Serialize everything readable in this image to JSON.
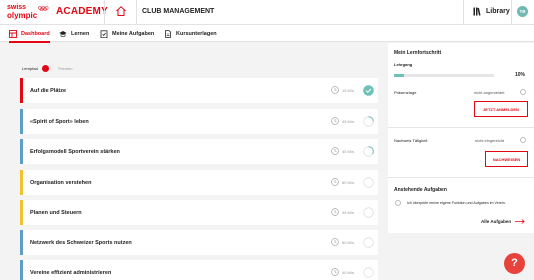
{
  "brand": {
    "line1": "swiss",
    "line2": "olympic",
    "academy": "ACADEMY",
    "accent": "#e30613"
  },
  "header": {
    "title": "CLUB MANAGEMENT",
    "library": "Library",
    "avatar": "TB"
  },
  "nav": {
    "tabs": [
      {
        "label": "Dashboard",
        "icon": "dashboard-icon",
        "active": true
      },
      {
        "label": "Lernen",
        "icon": "graduation-cap-icon"
      },
      {
        "label": "Meine Aufgaben",
        "icon": "clipboard-check-icon"
      },
      {
        "label": "Kursunterlagen",
        "icon": "document-icon"
      }
    ]
  },
  "toggle": {
    "left": "Lernpfad",
    "right": "Themen"
  },
  "courses": [
    {
      "title": "Auf die Plätze",
      "duration": "15 Min.",
      "status": "done",
      "color": "red"
    },
    {
      "title": "«Spirit of Sport» leben",
      "duration": "45 Min.",
      "status": "partial",
      "color": "blue"
    },
    {
      "title": "Erfolgsmodell Sportverein stärken",
      "duration": "45 Min.",
      "status": "partial",
      "color": "blue"
    },
    {
      "title": "Organisation verstehen",
      "duration": "60 Min.",
      "status": "empty",
      "color": "yellow"
    },
    {
      "title": "Planen und Steuern",
      "duration": "45 Min.",
      "status": "empty",
      "color": "yellow"
    },
    {
      "title": "Netzwerk des Schweizer Sports nutzen",
      "duration": "60 Min.",
      "status": "empty",
      "color": "blue"
    },
    {
      "title": "Vereine effizient administrieren",
      "duration": "40 Min.",
      "status": "empty",
      "color": "blue"
    }
  ],
  "progress_panel": {
    "title": "Mein Lernfortschritt",
    "lehrgang_label": "Lehrgang",
    "percent_label": "10%",
    "percent": 10,
    "praesenztage_label": "Präsenztage",
    "praesenztage_status": "nicht angemeldet",
    "anmelden_button": "JETZT ANMELDEN",
    "nachweis_label": "Nachweis Tätigkeit",
    "nachweis_status": "nicht eingereicht",
    "nachweisen_button": "NACHWEISEN"
  },
  "tasks_panel": {
    "title": "Anstehende Aufgaben",
    "task_text": "Ich überprüfe meine eigene Funktion und Aufgaben im Verein.",
    "all_link": "Alle Aufgaben"
  },
  "help": {
    "label": "?"
  }
}
